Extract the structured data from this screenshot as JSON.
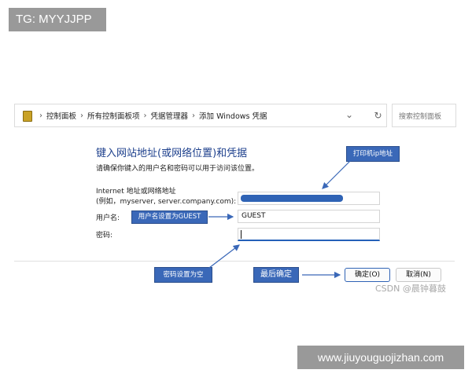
{
  "watermark": {
    "tag": "TG: MYYJJPP",
    "site": "www.jiuyouguojizhan.com",
    "csdn": "CSDN @晨钟暮鼓"
  },
  "address_bar": {
    "breadcrumb": [
      "控制面板",
      "所有控制面板项",
      "凭据管理器",
      "添加 Windows 凭据"
    ],
    "search_placeholder": "搜索控制面板"
  },
  "form": {
    "heading": "键入网站地址(或网络位置)和凭据",
    "subtext": "请确保你键入的用户名和密码可以用于访问该位置。",
    "address_label_line1": "Internet 地址或网络地址",
    "address_label_line2": "(例如，myserver, server.company.com):",
    "address_value": "",
    "username_label": "用户名:",
    "username_value": "GUEST",
    "password_label": "密码:",
    "password_value": ""
  },
  "buttons": {
    "ok": "确定(O)",
    "cancel": "取消(N)"
  },
  "annotations": {
    "printer": "打印机ip地址",
    "guest": "用户名设置为GUEST",
    "password": "密码设置为空",
    "confirm": "最后确定"
  },
  "colors": {
    "accent": "#2f63b5",
    "annotation_bg": "#3a68b8",
    "heading": "#1c3f8c"
  }
}
